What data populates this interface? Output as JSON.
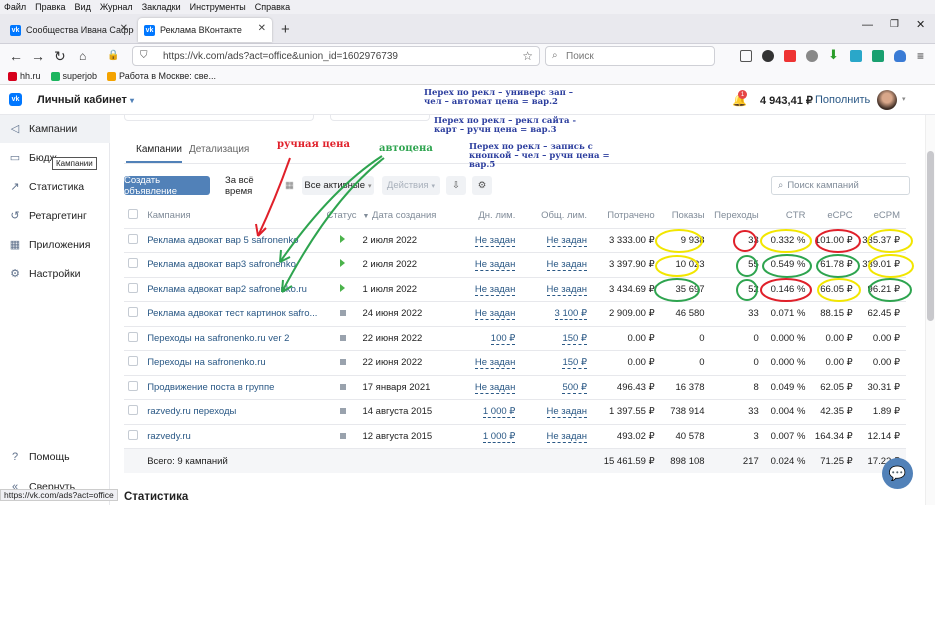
{
  "menu": [
    "Файл",
    "Правка",
    "Вид",
    "Журнал",
    "Закладки",
    "Инструменты",
    "Справка"
  ],
  "tabs": [
    {
      "title": "Сообщества Ивана Сафронен"
    },
    {
      "title": "Реклама ВКонтакте"
    }
  ],
  "url": "https://vk.com/ads?act=office&union_id=1602976739",
  "search_placeholder": "Поиск",
  "bookmarks": [
    {
      "label": "hh.ru",
      "color": "#d6001c"
    },
    {
      "label": "superjob",
      "color": "#1cb55e"
    },
    {
      "label": "Работа в Москве: све...",
      "color": "#f4a300"
    }
  ],
  "header": {
    "title": "Личный кабинет",
    "balance": "4 943,41 ₽",
    "topup": "Пополнить",
    "notif_count": "1"
  },
  "sidebar": {
    "items": [
      {
        "label": "Кампании",
        "icon": "campaign-icon"
      },
      {
        "label": "Бюдж",
        "icon": "wallet-icon"
      },
      {
        "label": "Статистика",
        "icon": "chart-icon"
      },
      {
        "label": "Ретаргетинг",
        "icon": "retarget-icon"
      },
      {
        "label": "Приложения",
        "icon": "apps-icon"
      },
      {
        "label": "Настройки",
        "icon": "settings-icon"
      }
    ],
    "tooltip": "Кампании",
    "help": "Помощь",
    "collapse": "Свернуть"
  },
  "main_tabs": [
    "Кампании",
    "Детализация"
  ],
  "toolbar": {
    "create": "Создать объявление",
    "period": "За всё время",
    "filter": "Все активные",
    "actions": "Действия",
    "search_placeholder": "Поиск кампаний"
  },
  "columns": [
    "Кампания",
    "Статус",
    "Дата создания",
    "Дн. лим.",
    "Общ. лим.",
    "Потрачено",
    "Показы",
    "Переходы",
    "CTR",
    "eCPC",
    "eCPM"
  ],
  "rows": [
    {
      "name": "Реклама адвокат вар 5 safronenko",
      "status": "active",
      "date": "2 июля 2022",
      "day": "Не задан",
      "total": "Не задан",
      "spent": "3 333.00 ₽",
      "shows": "9 938",
      "clicks": "33",
      "ctr": "0.332 %",
      "ecpc": "101.00 ₽",
      "ecpm": "335.37 ₽"
    },
    {
      "name": "Реклама адвокат вар3 safronenko",
      "status": "active",
      "date": "2 июля 2022",
      "day": "Не задан",
      "total": "Не задан",
      "spent": "3 397.90 ₽",
      "shows": "10 023",
      "clicks": "55",
      "ctr": "0.549 %",
      "ecpc": "61.78 ₽",
      "ecpm": "339.01 ₽"
    },
    {
      "name": "Реклама адвокат вар2 safronenko.ru",
      "status": "active",
      "date": "1 июля 2022",
      "day": "Не задан",
      "total": "Не задан",
      "spent": "3 434.69 ₽",
      "shows": "35 697",
      "clicks": "52",
      "ctr": "0.146 %",
      "ecpc": "66.05 ₽",
      "ecpm": "96.21 ₽"
    },
    {
      "name": "Реклама адвокат тест картинок safro...",
      "status": "stopped",
      "date": "24 июня 2022",
      "day": "Не задан",
      "total": "3 100 ₽",
      "spent": "2 909.00 ₽",
      "shows": "46 580",
      "clicks": "33",
      "ctr": "0.071 %",
      "ecpc": "88.15 ₽",
      "ecpm": "62.45 ₽"
    },
    {
      "name": "Переходы на safronenko.ru ver 2",
      "status": "stopped",
      "date": "22 июня 2022",
      "day": "100 ₽",
      "total": "150 ₽",
      "spent": "0.00 ₽",
      "shows": "0",
      "clicks": "0",
      "ctr": "0.000 %",
      "ecpc": "0.00 ₽",
      "ecpm": "0.00 ₽"
    },
    {
      "name": "Переходы на safronenko.ru",
      "status": "stopped",
      "date": "22 июня 2022",
      "day": "Не задан",
      "total": "150 ₽",
      "spent": "0.00 ₽",
      "shows": "0",
      "clicks": "0",
      "ctr": "0.000 %",
      "ecpc": "0.00 ₽",
      "ecpm": "0.00 ₽"
    },
    {
      "name": "Продвижение поста в группе",
      "status": "stopped",
      "date": "17 января 2021",
      "day": "Не задан",
      "total": "500 ₽",
      "spent": "496.43 ₽",
      "shows": "16 378",
      "clicks": "8",
      "ctr": "0.049 %",
      "ecpc": "62.05 ₽",
      "ecpm": "30.31 ₽"
    },
    {
      "name": "razvedy.ru переходы",
      "status": "stopped",
      "date": "14 августа 2015",
      "day": "1 000 ₽",
      "total": "Не задан",
      "spent": "1 397.55 ₽",
      "shows": "738 914",
      "clicks": "33",
      "ctr": "0.004 %",
      "ecpc": "42.35 ₽",
      "ecpm": "1.89 ₽"
    },
    {
      "name": "razvedy.ru",
      "status": "stopped",
      "date": "12 августа 2015",
      "day": "1 000 ₽",
      "total": "Не задан",
      "spent": "493.02 ₽",
      "shows": "40 578",
      "clicks": "3",
      "ctr": "0.007 %",
      "ecpc": "164.34 ₽",
      "ecpm": "12.14 ₽"
    }
  ],
  "totals": {
    "label": "Всего: 9 кампаний",
    "spent": "15 461.59 ₽",
    "shows": "898 108",
    "clicks": "217",
    "ctr": "0.024 %",
    "ecpc": "71.25 ₽",
    "ecpm": "17.22 ₽"
  },
  "section_title": "Статистика",
  "status_url": "https://vk.com/ads?act=office",
  "annotations": {
    "a1": "Перех по рекл – универс зап – чел – автомат цена = вар.2",
    "a2": "Перех по рекл – рекл сайта - карт – ручн цена = вар.3",
    "a3": "Перех по рекл – запись с кнопкой – чел – ручн цена = вар.5",
    "manual": "ручная цена",
    "auto": "автоцена"
  },
  "colors": {
    "vk_blue": "#0077ff",
    "link": "#2a5885",
    "annot_red": "#e0202a",
    "annot_green": "#2ea44f",
    "annot_yellow": "#f2e600"
  }
}
